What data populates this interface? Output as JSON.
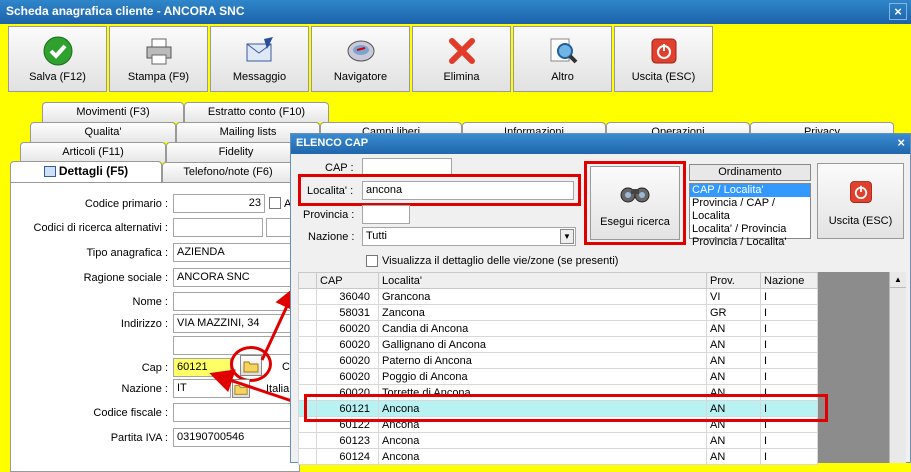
{
  "window": {
    "title": "Scheda anagrafica cliente - ANCORA SNC",
    "close": "×"
  },
  "toolbar": [
    {
      "label": "Salva (F12)",
      "icon": "check-icon"
    },
    {
      "label": "Stampa (F9)",
      "icon": "printer-icon"
    },
    {
      "label": "Messaggio",
      "icon": "mail-icon"
    },
    {
      "label": "Navigatore",
      "icon": "compass-icon"
    },
    {
      "label": "Elimina",
      "icon": "delete-icon"
    },
    {
      "label": "Altro",
      "icon": "magnifier-icon"
    },
    {
      "label": "Uscita (ESC)",
      "icon": "exit-icon"
    }
  ],
  "tabs": {
    "row1": [
      "Movimenti (F3)",
      "Estratto conto (F10)"
    ],
    "row2": [
      "Qualita'",
      "Mailing lists",
      "Campi liberi",
      "Informazioni",
      "Operazioni",
      "Privacy"
    ],
    "row3": [
      "Articoli (F11)",
      "Fidelity"
    ],
    "row4": [
      "Dettagli (F5)",
      "Telefono/note (F6)"
    ]
  },
  "form": {
    "codice_primario": {
      "label": "Codice primario :",
      "value": "23"
    },
    "codici_alt": {
      "label": "Codici di ricerca alternativi :"
    },
    "tipo": {
      "label": "Tipo anagrafica :",
      "value": "AZIENDA"
    },
    "ragione": {
      "label": "Ragione sociale :",
      "value": "ANCORA SNC"
    },
    "nome": {
      "label": "Nome :",
      "value": ""
    },
    "indirizzo": {
      "label": "Indirizzo :",
      "value": "VIA MAZZINI, 34"
    },
    "cap": {
      "label": "Cap :",
      "value": "60121"
    },
    "nazione": {
      "label": "Nazione :",
      "value": "IT",
      "extra": "Italia"
    },
    "codice_fiscale": {
      "label": "Codice fiscale :",
      "value": ""
    },
    "partita_iva": {
      "label": "Partita IVA :",
      "value": "03190700546"
    },
    "cap_side_label": "C",
    "a_label": "A"
  },
  "dialog": {
    "title": "ELENCO CAP",
    "cap_label": "CAP :",
    "cap_value": "",
    "localita_label": "Localita' :",
    "localita_value": "ancona",
    "provincia_label": "Provincia :",
    "provincia_value": "",
    "nazione_label": "Nazione :",
    "nazione_value": "Tutti",
    "checkbox_label": "Visualizza il dettaglio delle vie/zone (se presenti)",
    "search_button": "Esegui ricerca",
    "ordinamento_label": "Ordinamento",
    "ordinamento_options": [
      "CAP / Localita'",
      "Provincia / CAP / Localita",
      "Localita' / Provincia",
      "Provincia / Localita'"
    ],
    "exit_button": "Uscita (ESC)",
    "columns": [
      "CAP",
      "Localita'",
      "Prov.",
      "Nazione"
    ],
    "rows": [
      [
        "36040",
        "Grancona",
        "VI",
        "I"
      ],
      [
        "58031",
        "Zancona",
        "GR",
        "I"
      ],
      [
        "60020",
        "Candia di Ancona",
        "AN",
        "I"
      ],
      [
        "60020",
        "Gallignano di Ancona",
        "AN",
        "I"
      ],
      [
        "60020",
        "Paterno di Ancona",
        "AN",
        "I"
      ],
      [
        "60020",
        "Poggio di Ancona",
        "AN",
        "I"
      ],
      [
        "60020",
        "Torrette di Ancona",
        "AN",
        "I"
      ],
      [
        "60121",
        "Ancona",
        "AN",
        "I"
      ],
      [
        "60122",
        "Ancona",
        "AN",
        "I"
      ],
      [
        "60123",
        "Ancona",
        "AN",
        "I"
      ],
      [
        "60124",
        "Ancona",
        "AN",
        "I"
      ]
    ],
    "selected_row": 7
  },
  "colors": {
    "accent_red": "#e00000",
    "background": "#ffff00",
    "selection": "#b8f2f2"
  }
}
